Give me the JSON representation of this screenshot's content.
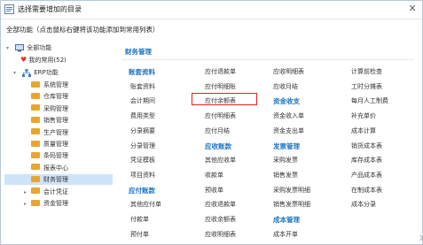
{
  "window": {
    "title": "选择需要增加的目录",
    "close_glyph": "✕"
  },
  "hint": "全部功能（点击鼠标右键将该功能添加到常用列表）",
  "tree": {
    "root": "全部功能",
    "favorites": "我的常用(52)",
    "erp": "ERP功能",
    "modules": [
      "系统管理",
      "仓库管理",
      "采购管理",
      "销售管理",
      "生产管理",
      "质量管理",
      "条码管理",
      "报表中心",
      "财务管理"
    ],
    "extra": [
      "会计凭证",
      "资金管理"
    ]
  },
  "content": {
    "section": "财务管理",
    "columns": [
      [
        {
          "t": "h",
          "v": "账套资料"
        },
        {
          "t": "i",
          "v": "账套资料"
        },
        {
          "t": "i",
          "v": "会计期间"
        },
        {
          "t": "i",
          "v": "费用类型"
        },
        {
          "t": "i",
          "v": "分录摘要"
        },
        {
          "t": "i",
          "v": "分录管理"
        },
        {
          "t": "i",
          "v": "凭证模板"
        },
        {
          "t": "i",
          "v": "项目资料"
        },
        {
          "t": "h",
          "v": "应付账款"
        },
        {
          "t": "i",
          "v": "其他应付单"
        },
        {
          "t": "i",
          "v": "付款单"
        },
        {
          "t": "i",
          "v": "预付单"
        }
      ],
      [
        {
          "t": "i",
          "v": "应付退款单"
        },
        {
          "t": "i",
          "v": "应付明细账"
        },
        {
          "t": "i",
          "v": "应付余额表"
        },
        {
          "t": "i",
          "v": "应付明细表"
        },
        {
          "t": "i",
          "v": "应付月结"
        },
        {
          "t": "h",
          "v": "应收账款"
        },
        {
          "t": "i",
          "v": "其他应收单"
        },
        {
          "t": "i",
          "v": "收款单"
        },
        {
          "t": "i",
          "v": "预收单"
        },
        {
          "t": "i",
          "v": "应收退款单"
        },
        {
          "t": "i",
          "v": "应收余额表"
        },
        {
          "t": "i",
          "v": "应收明细表"
        }
      ],
      [
        {
          "t": "i",
          "v": "应收明细表"
        },
        {
          "t": "i",
          "v": "应收月结"
        },
        {
          "t": "h",
          "v": "资金收支"
        },
        {
          "t": "i",
          "v": "资金收入单"
        },
        {
          "t": "i",
          "v": "资金支出单"
        },
        {
          "t": "h",
          "v": "发票管理"
        },
        {
          "t": "i",
          "v": "采购发票"
        },
        {
          "t": "i",
          "v": "销售发票"
        },
        {
          "t": "i",
          "v": "采购发票明细"
        },
        {
          "t": "i",
          "v": "销售发票明细"
        },
        {
          "t": "h",
          "v": "成本管理"
        },
        {
          "t": "i",
          "v": "成本开单"
        }
      ],
      [
        {
          "t": "i",
          "v": "计算前检查"
        },
        {
          "t": "i",
          "v": "工时分摊表"
        },
        {
          "t": "i",
          "v": "每月人工制费"
        },
        {
          "t": "i",
          "v": "补充单价"
        },
        {
          "t": "i",
          "v": "成本计算"
        },
        {
          "t": "i",
          "v": "销货成本表"
        },
        {
          "t": "i",
          "v": "库存成本表"
        },
        {
          "t": "i",
          "v": "产品成本表"
        },
        {
          "t": "i",
          "v": "在制成本表"
        },
        {
          "t": "i",
          "v": "成本分录"
        }
      ]
    ],
    "highlighted": "应付余额表"
  }
}
